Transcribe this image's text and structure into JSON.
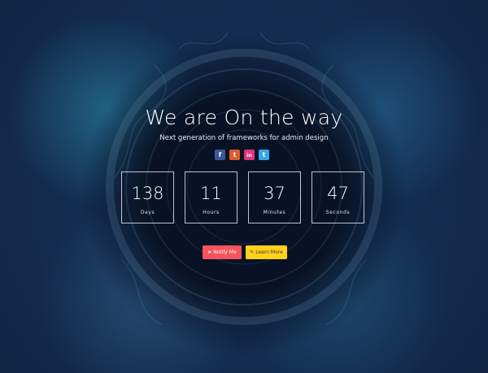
{
  "hero": {
    "title": "We are On the way",
    "subtitle": "Next generation of frameworks for admin design"
  },
  "social": [
    {
      "name": "facebook",
      "glyph": "f",
      "color": "#3b5998"
    },
    {
      "name": "twitter",
      "glyph": "t",
      "color": "#e05b2a"
    },
    {
      "name": "linkedin",
      "glyph": "in",
      "color": "#e0357a"
    },
    {
      "name": "twitter-alt",
      "glyph": "t",
      "color": "#36a7e6"
    }
  ],
  "countdown": [
    {
      "value": "138",
      "label": "Days"
    },
    {
      "value": "11",
      "label": "Hours"
    },
    {
      "value": "37",
      "label": "Minutes"
    },
    {
      "value": "47",
      "label": "Seconds"
    }
  ],
  "actions": {
    "notify_label": "Notify Me",
    "notify_icon": "send-icon",
    "learn_label": "Learn More",
    "learn_icon": "bulb-icon"
  }
}
